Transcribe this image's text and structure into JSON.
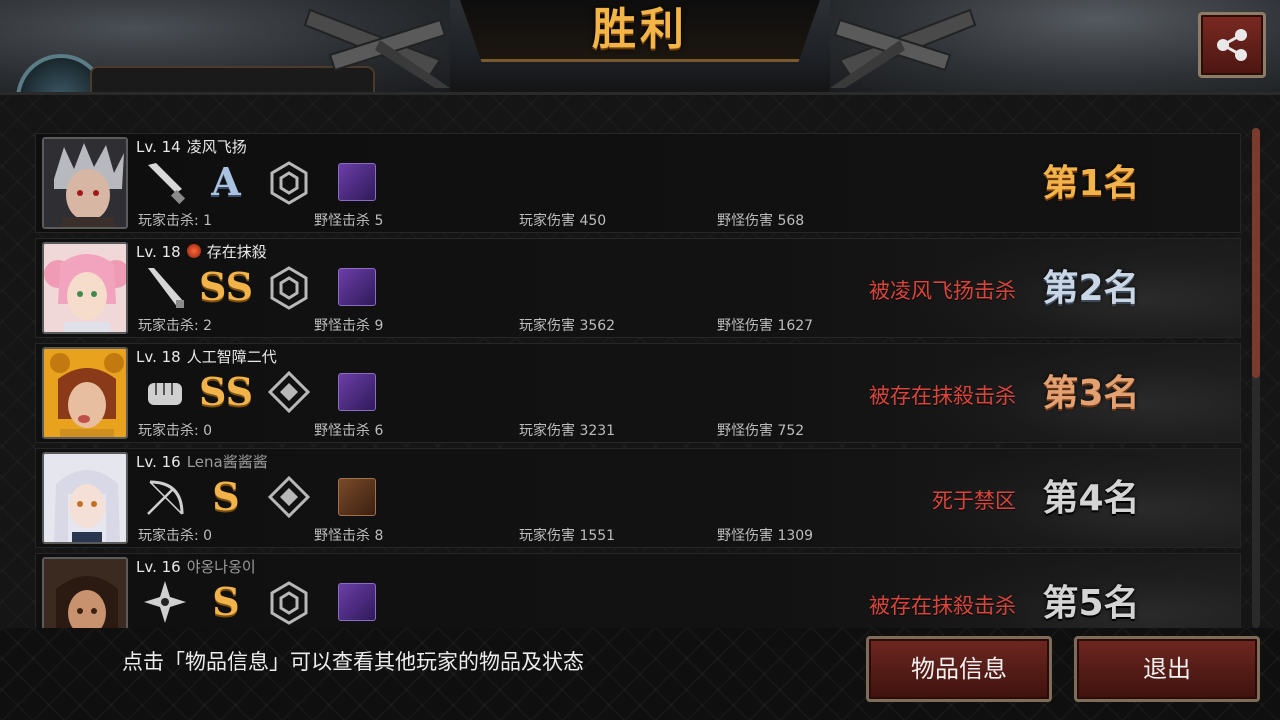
{
  "title": "胜利",
  "header": {
    "player_plate": ""
  },
  "rows": [
    {
      "level": "Lv. 14",
      "name": "凌风飞扬",
      "name_dim": false,
      "badge": false,
      "weapon_icon": "knife-icon",
      "grade": "A",
      "skill_icon": "hexagon-emblem-icon",
      "item_icon": "purple-item-icon",
      "player_kills": "玩家击杀: 1",
      "monster_kills": "野怪击杀 5",
      "player_damage": "玩家伤害 450",
      "monster_damage": "野怪伤害 568",
      "death_cause": "",
      "rank": "第1名"
    },
    {
      "level": "Lv. 18",
      "name": "存在抹殺",
      "name_dim": false,
      "badge": true,
      "weapon_icon": "bat-icon",
      "grade": "SS",
      "skill_icon": "hexagon-emblem-icon",
      "item_icon": "purple-item-icon",
      "player_kills": "玩家击杀: 2",
      "monster_kills": "野怪击杀 9",
      "player_damage": "玩家伤害 3562",
      "monster_damage": "野怪伤害 1627",
      "death_cause": "被凌风飞扬击杀",
      "rank": "第2名"
    },
    {
      "level": "Lv. 18",
      "name": "人工智障二代",
      "name_dim": false,
      "badge": false,
      "weapon_icon": "fist-icon",
      "grade": "SS",
      "skill_icon": "diamond-emblem-icon",
      "item_icon": "purple-item-icon",
      "player_kills": "玩家击杀: 0",
      "monster_kills": "野怪击杀 6",
      "player_damage": "玩家伤害 3231",
      "monster_damage": "野怪伤害 752",
      "death_cause": "被存在抹殺击杀",
      "rank": "第3名"
    },
    {
      "level": "Lv. 16",
      "name": "Lena酱酱酱",
      "name_dim": true,
      "badge": false,
      "weapon_icon": "bow-icon",
      "grade": "S",
      "skill_icon": "diamond-emblem-icon",
      "item_icon": "crossed-swords-item-icon",
      "player_kills": "玩家击杀: 0",
      "monster_kills": "野怪击杀 8",
      "player_damage": "玩家伤害 1551",
      "monster_damage": "野怪伤害 1309",
      "death_cause": "死于禁区",
      "rank": "第4名"
    },
    {
      "level": "Lv. 16",
      "name": "야옹나옹이",
      "name_dim": true,
      "badge": false,
      "weapon_icon": "shuriken-icon",
      "grade": "S",
      "skill_icon": "hexagon-emblem-icon",
      "item_icon": "purple-item-icon",
      "player_kills": "",
      "monster_kills": "",
      "player_damage": "",
      "monster_damage": "",
      "death_cause": "被存在抹殺击杀",
      "rank": "第5名"
    }
  ],
  "footer": {
    "hint": "点击「物品信息」可以查看其他玩家的物品及状态",
    "items_button": "物品信息",
    "exit_button": "退出"
  },
  "colors": {
    "gold": "#f2b34a",
    "death_red": "#d9453a",
    "button_red": "#6e2720"
  }
}
